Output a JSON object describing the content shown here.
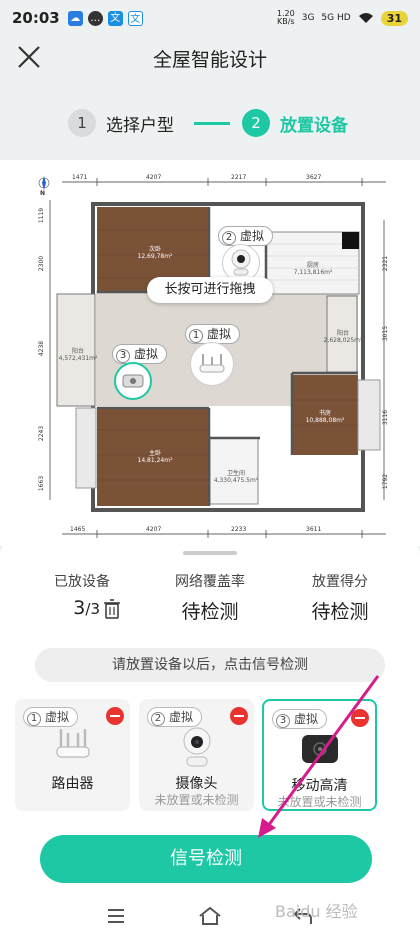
{
  "status_bar": {
    "time": "20:03",
    "app_icons": [
      "baidu-cloud-icon",
      "message-icon",
      "translate-icon",
      "translate-alt-icon"
    ],
    "net_speed_value": "1.20",
    "net_speed_unit": "KB/s",
    "sim1": "3G",
    "sim2": "5G HD",
    "battery": "31"
  },
  "header": {
    "title": "全屋智能设计",
    "close_icon": "close-icon"
  },
  "steps": [
    {
      "number": "1",
      "label": "选择户型",
      "active": false
    },
    {
      "number": "2",
      "label": "放置设备",
      "active": true
    }
  ],
  "floor_plan": {
    "top_dims": [
      "1471",
      "4207",
      "2217",
      "3627"
    ],
    "bottom_dims": [
      "1465",
      "4207",
      "2233",
      "3611"
    ],
    "left_dims": [
      "1119",
      "2300",
      "4238",
      "2243",
      "1663"
    ],
    "right_dims": [
      "2321",
      "3015",
      "3116",
      "1792"
    ],
    "rooms": [
      {
        "name": "次卧",
        "area": "12,69,78m²"
      },
      {
        "name": "厨房",
        "area": "7,113,816m²"
      },
      {
        "name": "阳台",
        "area": "4,572,431m²"
      },
      {
        "name": "阳台",
        "area": "2,628,025m²"
      },
      {
        "name": "主卧",
        "area": "14,81,24m²"
      },
      {
        "name": "卫生间",
        "area": "4,330,475.5m²"
      },
      {
        "name": "书房",
        "area": "10,888,08m²"
      }
    ],
    "drag_hint": "长按可进行拖拽",
    "markers": [
      {
        "number": "2",
        "label": "虚拟"
      },
      {
        "number": "1",
        "label": "虚拟"
      },
      {
        "number": "3",
        "label": "虚拟"
      }
    ],
    "compass": "N"
  },
  "stats": [
    {
      "label": "已放设备",
      "value": "3",
      "total": "/3"
    },
    {
      "label": "网络覆盖率",
      "value": "待检测"
    },
    {
      "label": "放置得分",
      "value": "待检测"
    }
  ],
  "hint": "请放置设备以后，点击信号检测",
  "devices": [
    {
      "number": "1",
      "tag": "虚拟",
      "name": "路由器",
      "status": "",
      "selected": false,
      "icon": "router-icon"
    },
    {
      "number": "2",
      "tag": "虚拟",
      "name": "摄像头",
      "status": "未放置或未检测",
      "selected": false,
      "icon": "camera-icon"
    },
    {
      "number": "3",
      "tag": "虚拟",
      "name": "移动高清",
      "status": "未放置或未检测",
      "selected": true,
      "icon": "tv-box-icon"
    }
  ],
  "detect_button": "信号检测",
  "nav": [
    "menu-icon",
    "home-icon",
    "back-icon"
  ],
  "watermark": "Baidu 经验",
  "colors": {
    "accent": "#1ec8a4",
    "danger": "#e8332f",
    "annotation": "#d61c8c"
  }
}
